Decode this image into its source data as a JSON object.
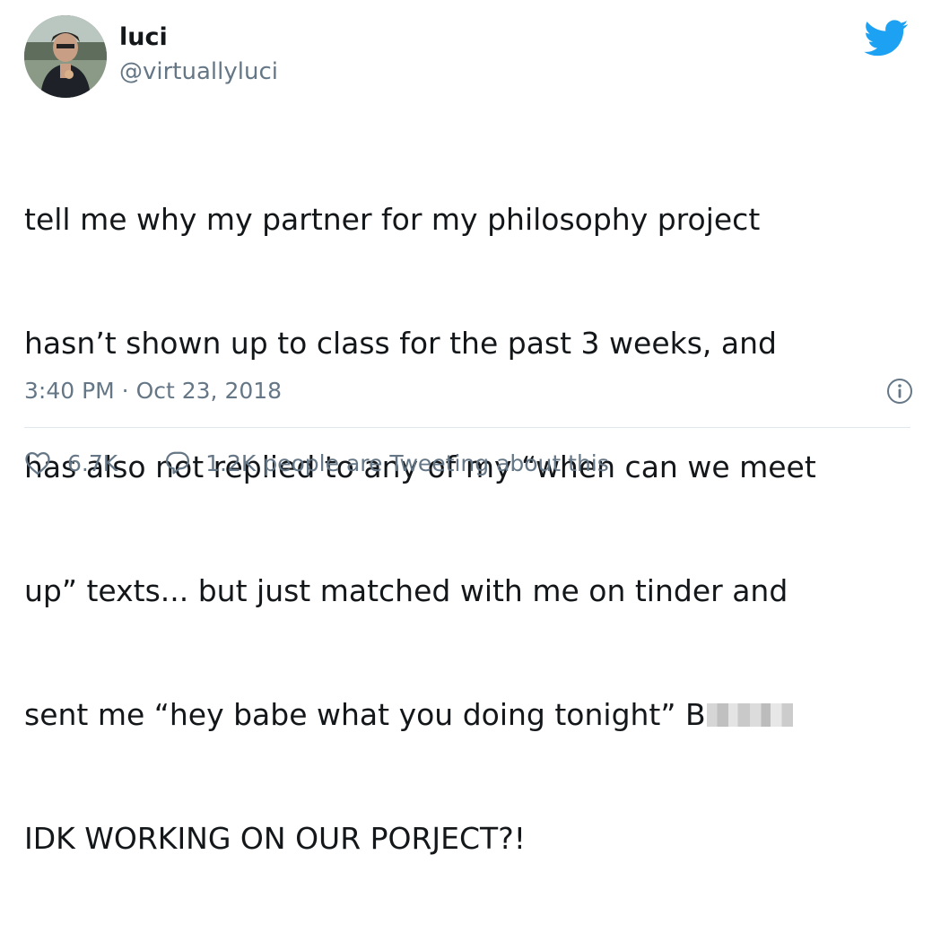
{
  "author": {
    "display_name": "luci",
    "handle": "@virtuallyluci"
  },
  "tweet": {
    "lines": [
      "tell me why my partner for my philosophy project",
      "hasn’t shown up to class for the past 3 weeks, and",
      "has also not replied to any of my “when can we meet",
      "up” texts... but just matched with me on tinder and",
      "sent me “hey babe what you doing tonight” B",
      "IDK WORKING ON OUR PORJECT?!"
    ],
    "timestamp": "3:40 PM · Oct 23, 2018"
  },
  "actions": {
    "like_count": "6.7K",
    "reply_text": "1.2K people are Tweeting about this"
  },
  "icons": {
    "brand": "twitter-bird-icon",
    "info": "info-icon",
    "like": "heart-icon",
    "reply": "speech-bubble-icon"
  },
  "colors": {
    "brand_blue": "#1da1f2",
    "text_primary": "#14171a",
    "text_secondary": "#657786",
    "divider": "#e1e8ed"
  }
}
